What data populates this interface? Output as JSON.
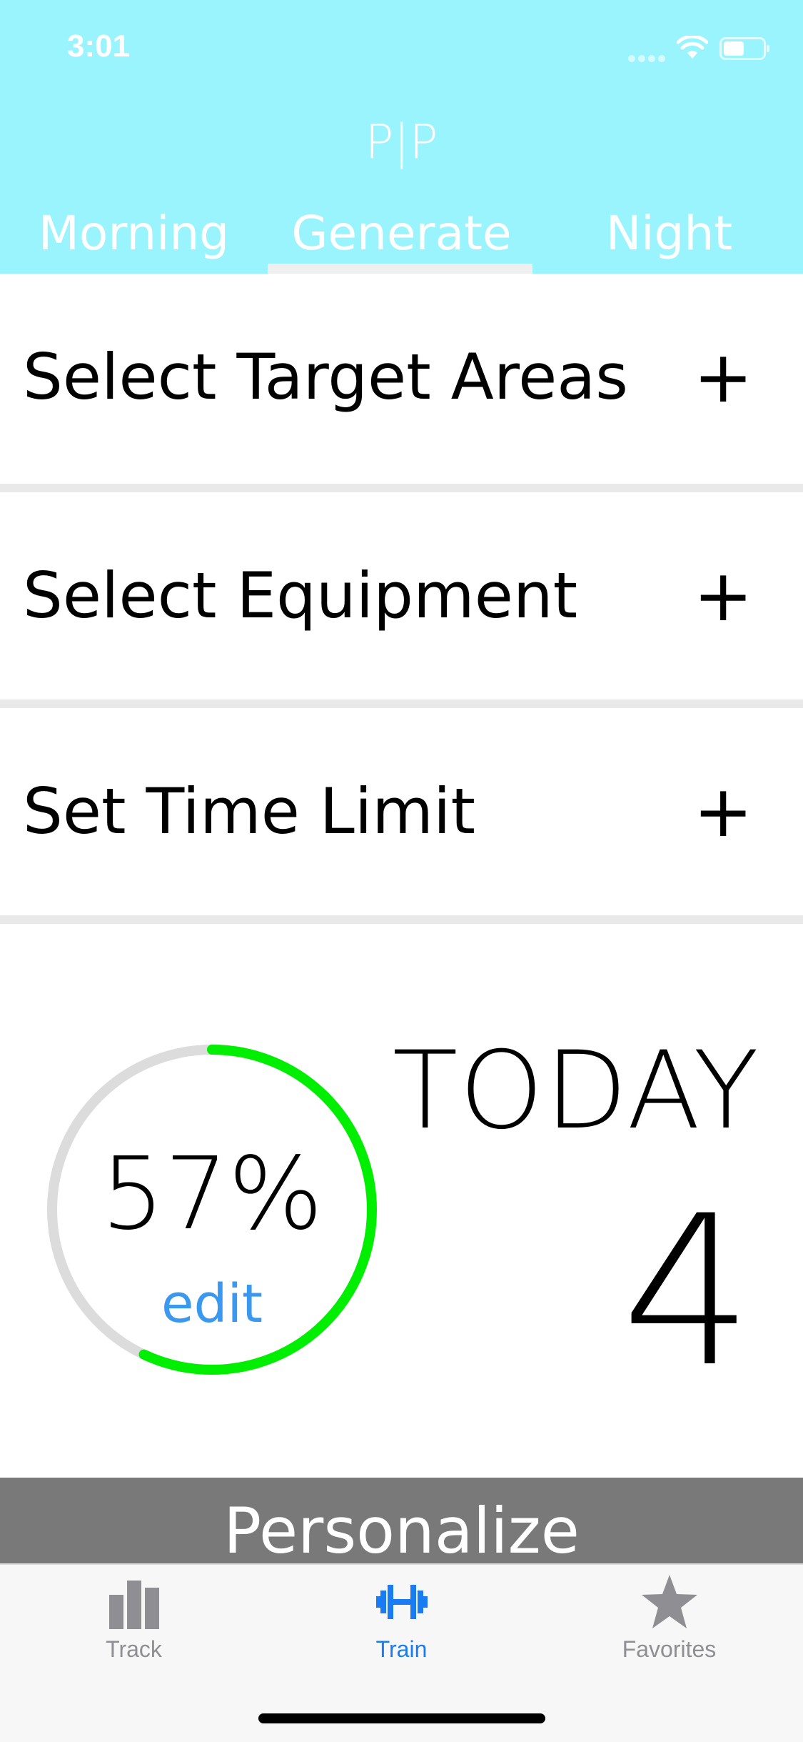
{
  "status_bar": {
    "time": "3:01"
  },
  "header": {
    "title": "P|P",
    "tabs": [
      {
        "label": "Morning"
      },
      {
        "label": "Generate"
      },
      {
        "label": "Night"
      }
    ],
    "active_tab": "Generate",
    "background_color": "#9af4fe"
  },
  "options": [
    {
      "label": "Select Target Areas",
      "action": "+"
    },
    {
      "label": "Select Equipment",
      "action": "+"
    },
    {
      "label": "Set Time Limit",
      "action": "+"
    }
  ],
  "progress": {
    "percent_label": "57%",
    "value": 0.57,
    "edit_label": "edit",
    "ring_color": "#00ee00",
    "track_color": "#dcdcdc"
  },
  "today": {
    "label": "TODAY",
    "count": "4"
  },
  "personalize": {
    "label": "Personalize"
  },
  "tabbar": {
    "items": [
      {
        "label": "Track",
        "icon": "bar-chart-icon"
      },
      {
        "label": "Train",
        "icon": "dumbbell-icon"
      },
      {
        "label": "Favorites",
        "icon": "star-icon"
      }
    ],
    "active": "Train",
    "active_color": "#1a7cf2"
  }
}
